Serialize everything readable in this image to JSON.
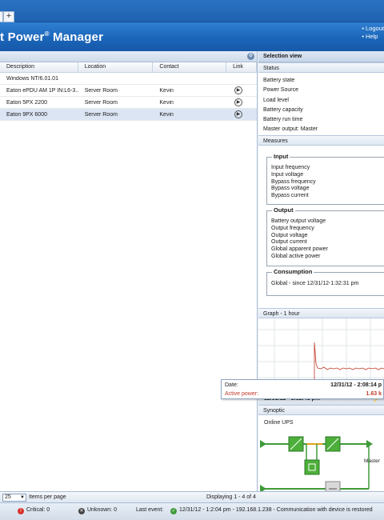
{
  "header": {
    "title": "t Power",
    "title_suffix": " Manager",
    "reg": "®",
    "links": [
      "Logout",
      "Help"
    ]
  },
  "grid": {
    "columns": [
      "Description",
      "Location",
      "Contact",
      "Link"
    ],
    "rows": [
      {
        "description": "Windows NT/6.01.01",
        "location": "",
        "contact": ""
      },
      {
        "description": "Eaton ePDU AM 1P IN:L6-3...",
        "location": "Server Room",
        "contact": "Kevin"
      },
      {
        "description": "Eaton 5PX 2200",
        "location": "Server Room",
        "contact": "Kevin"
      },
      {
        "description": "Eaton 9PX 6000",
        "location": "Server Room",
        "contact": "Kevin"
      }
    ]
  },
  "side": {
    "title": "Selection view",
    "status_head": "Status",
    "status_items": [
      "Battery state",
      "Power Source",
      "Load level",
      "Battery capacity",
      "Battery run time",
      "Master output: Master"
    ],
    "measures_head": "Measures",
    "input_legend": "Input",
    "input_items": [
      "Input frequency",
      "Input voltage",
      "Bypass frequency",
      "Bypass voltage",
      "Bypass current"
    ],
    "output_legend": "Output",
    "output_items": [
      "Battery output voltage",
      "Output frequency",
      "Output voltage",
      "Output current",
      "Global apparent power",
      "Global active power"
    ],
    "consumption_legend": "Consumption",
    "consumption_text": "Global - since 12/31/12-1:32:31 pm",
    "graph_head": "Graph - 1 hour",
    "graph_foot": "12/31/12 - 1:32:41 pm",
    "synoptic_head": "Synoptic",
    "synoptic_type": "Online UPS",
    "synoptic_master": "Master"
  },
  "tooltip": {
    "date_label": "Date:",
    "date_value": "12/31/12 - 2:08:14 p",
    "power_label": "Active power:",
    "power_value": "1.63 k"
  },
  "pager": {
    "page_size": "25",
    "items_label": "Items per page",
    "display": "Displaying 1 - 4 of 4"
  },
  "status": {
    "critical": "Critical: 0",
    "unknown": "Unknown: 0",
    "last_events_label": "Last event:",
    "last_event": "12/31/12 - 1:2:04 pm - 192.168.1.238 - Communication with device is restored"
  },
  "colors": {
    "header_blue": "#1a64b8",
    "graph_red": "#c0392b",
    "ups_green": "#4caf3a"
  }
}
